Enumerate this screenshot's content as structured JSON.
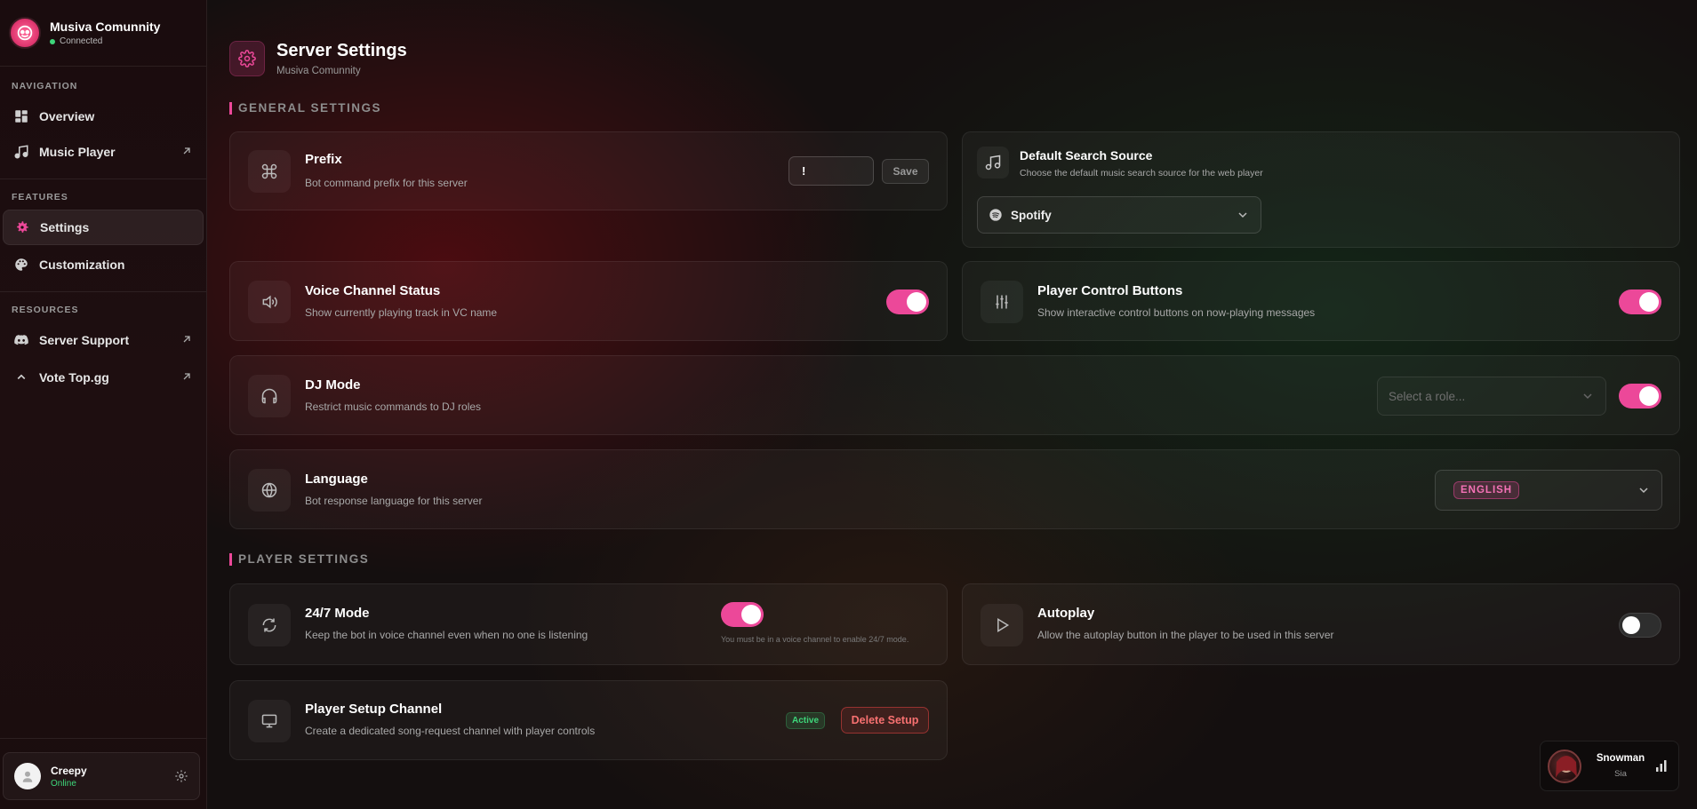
{
  "sidebar": {
    "server_name": "Musiva Comunnity",
    "server_status": "Connected",
    "sections": {
      "navigation": "NAVIGATION",
      "features": "FEATURES",
      "resources": "RESOURCES"
    },
    "items": {
      "overview": "Overview",
      "music_player": "Music Player",
      "settings": "Settings",
      "customization": "Customization",
      "server_support": "Server Support",
      "vote": "Vote Top.gg"
    },
    "user": {
      "name": "Creepy",
      "status": "Online"
    }
  },
  "header": {
    "title": "Server Settings",
    "subtitle": "Musiva Comunnity"
  },
  "general": {
    "title": "GENERAL SETTINGS",
    "prefix": {
      "title": "Prefix",
      "desc": "Bot command prefix for this server",
      "value": "!",
      "save_label": "Save"
    },
    "search_source": {
      "title": "Default Search Source",
      "desc": "Choose the default music search source for the web player",
      "value": "Spotify"
    },
    "voice_status": {
      "title": "Voice Channel Status",
      "desc": "Show currently playing track in VC name",
      "enabled": true
    },
    "control_buttons": {
      "title": "Player Control Buttons",
      "desc": "Show interactive control buttons on now-playing messages",
      "enabled": true
    },
    "dj_mode": {
      "title": "DJ Mode",
      "desc": "Restrict music commands to DJ roles",
      "placeholder": "Select a role...",
      "enabled": true
    },
    "language": {
      "title": "Language",
      "desc": "Bot response language for this server",
      "value": "ENGLISH"
    }
  },
  "player": {
    "title": "PLAYER SETTINGS",
    "mode247": {
      "title": "24/7 Mode",
      "desc": "Keep the bot in voice channel even when no one is listening",
      "note": "You must be in a voice channel to enable 24/7 mode.",
      "enabled": true
    },
    "autoplay": {
      "title": "Autoplay",
      "desc": "Allow the autoplay button in the player to be used in this server",
      "enabled": false
    },
    "setup_channel": {
      "title": "Player Setup Channel",
      "desc": "Create a dedicated song-request channel with player controls",
      "status": "Active",
      "delete_label": "Delete Setup"
    }
  },
  "now_playing": {
    "title": "Snowman",
    "artist": "Sia"
  },
  "colors": {
    "accent": "#ec4899",
    "online": "#3ed67a",
    "danger": "#f87171"
  }
}
